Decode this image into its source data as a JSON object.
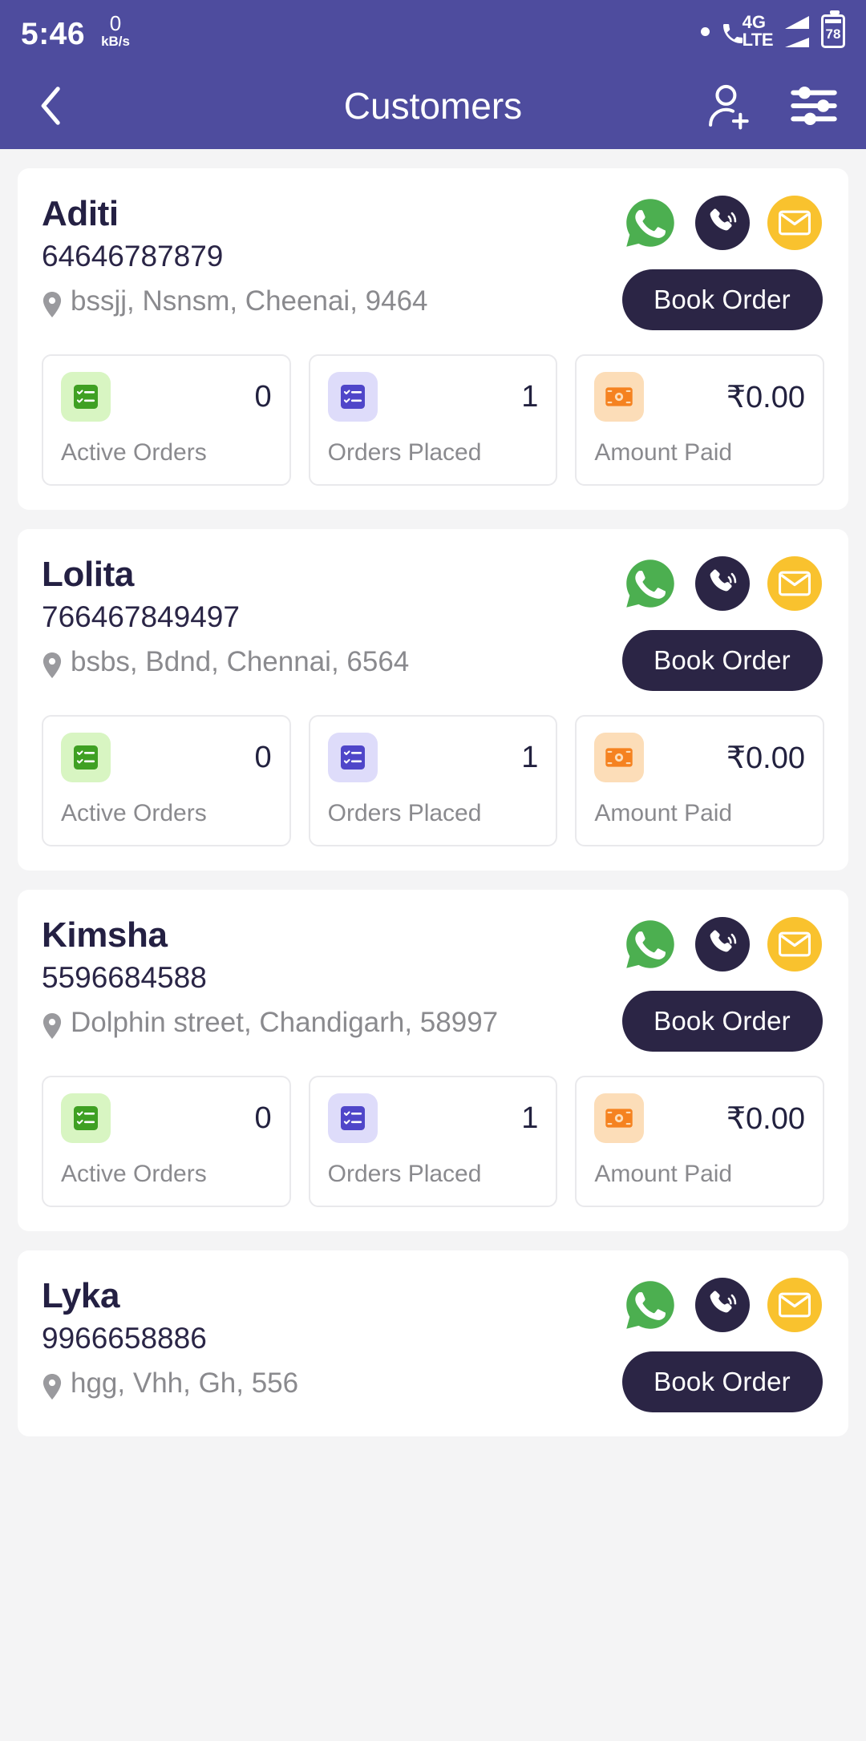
{
  "status_bar": {
    "time": "5:46",
    "net_speed_value": "0",
    "net_speed_unit": "kB/s",
    "network_type": "4G",
    "network_label": "LTE",
    "battery_percent": "78",
    "icons": [
      "recording-dot-icon",
      "signal-4g-lte-icon",
      "signal-bars-icon",
      "battery-icon"
    ]
  },
  "app_bar": {
    "title": "Customers",
    "back_icon": "chevron-left-icon",
    "add_customer_icon": "add-user-icon",
    "filter_icon": "filter-sliders-icon"
  },
  "labels": {
    "active_orders": "Active Orders",
    "orders_placed": "Orders Placed",
    "amount_paid": "Amount Paid",
    "book_order": "Book Order",
    "whatsapp_icon": "whatsapp-icon",
    "call_icon": "phone-call-icon",
    "email_icon": "email-icon",
    "location_icon": "location-pin-icon",
    "active_orders_icon": "checklist-green-icon",
    "orders_placed_icon": "checklist-purple-icon",
    "amount_paid_icon": "banknote-orange-icon"
  },
  "colors": {
    "header": "#4E4C9E",
    "page_bg": "#F4F4F5",
    "card_bg": "#FFFFFF",
    "dark_navy": "#2B2545",
    "whatsapp_green": "#4CAF50",
    "email_yellow": "#F9C22E",
    "muted_text": "#8A8A8E",
    "name_text": "#242043"
  },
  "customers": [
    {
      "name": "Aditi",
      "phone": "64646787879",
      "address": "bssjj, Nsnsm, Cheenai, 9464",
      "active_orders": "0",
      "orders_placed": "1",
      "amount_paid": "₹0.00"
    },
    {
      "name": "Lolita",
      "phone": "766467849497",
      "address": "bsbs, Bdnd, Chennai, 6564",
      "active_orders": "0",
      "orders_placed": "1",
      "amount_paid": "₹0.00"
    },
    {
      "name": "Kimsha",
      "phone": "5596684588",
      "address": "Dolphin street, Chandigarh, 58997",
      "active_orders": "0",
      "orders_placed": "1",
      "amount_paid": "₹0.00"
    },
    {
      "name": "Lyka",
      "phone": "9966658886",
      "address": "hgg, Vhh, Gh, 556",
      "active_orders": "",
      "orders_placed": "",
      "amount_paid": ""
    }
  ]
}
